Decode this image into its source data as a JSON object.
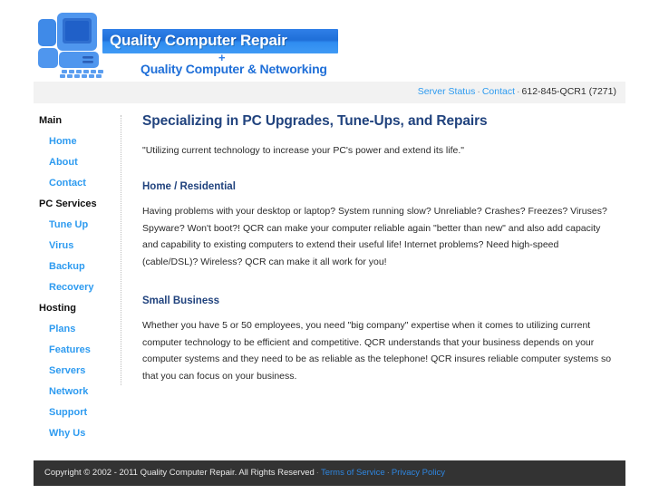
{
  "header": {
    "logo_icon": "computer-desktop-icon",
    "brand_primary": "Quality Computer Repair",
    "brand_plus": "+",
    "brand_secondary": "Quality Computer & Networking"
  },
  "topbar": {
    "server_status_label": "Server Status",
    "sep1": "·",
    "contact_label": "Contact",
    "sep2": "·",
    "phone": "612-845-QCR1 (7271)"
  },
  "sidebar": {
    "groups": [
      {
        "title": "Main",
        "items": [
          {
            "label": "Home"
          },
          {
            "label": "About"
          },
          {
            "label": "Contact"
          }
        ]
      },
      {
        "title": "PC Services",
        "items": [
          {
            "label": "Tune Up"
          },
          {
            "label": "Virus"
          },
          {
            "label": "Backup"
          },
          {
            "label": "Recovery"
          }
        ]
      },
      {
        "title": "Hosting",
        "items": [
          {
            "label": "Plans"
          },
          {
            "label": "Features"
          },
          {
            "label": "Servers"
          },
          {
            "label": "Network"
          },
          {
            "label": "Support"
          },
          {
            "label": "Why Us"
          }
        ]
      }
    ]
  },
  "main": {
    "page_title": "Specializing in PC Upgrades, Tune-Ups, and Repairs",
    "tagline": "\"Utilizing current technology to increase your PC's power and extend its life.\"",
    "sections": [
      {
        "title": "Home / Residential",
        "body": "Having problems with your desktop or laptop? System running slow? Unreliable? Crashes? Freezes? Viruses? Spyware? Won't boot?! QCR can make your computer reliable again \"better than new\" and also add capacity and capability to existing computers to extend their useful life! Internet problems? Need high-speed (cable/DSL)? Wireless? QCR can make it all work for you!"
      },
      {
        "title": "Small Business",
        "body": "Whether you have 5 or 50 employees, you need \"big company\" expertise when it comes to utilizing current computer technology to be efficient and competitive. QCR understands that your business depends on your computer systems and they need to be as reliable as the telephone! QCR insures reliable computer systems so that you can focus on your business."
      }
    ]
  },
  "footer": {
    "copyright": "Copyright © 2002 - 2011 Quality Computer Repair. All Rights Reserved",
    "sep1": "·",
    "terms_label": "Terms of Service",
    "sep2": "·",
    "privacy_label": "Privacy Policy"
  },
  "colors": {
    "link_blue": "#2e9bf0",
    "heading_navy": "#21437e",
    "brand_band_blue": "#1f6fd8",
    "topbar_gray": "#f2f2f2",
    "footer_dark": "#333333"
  }
}
